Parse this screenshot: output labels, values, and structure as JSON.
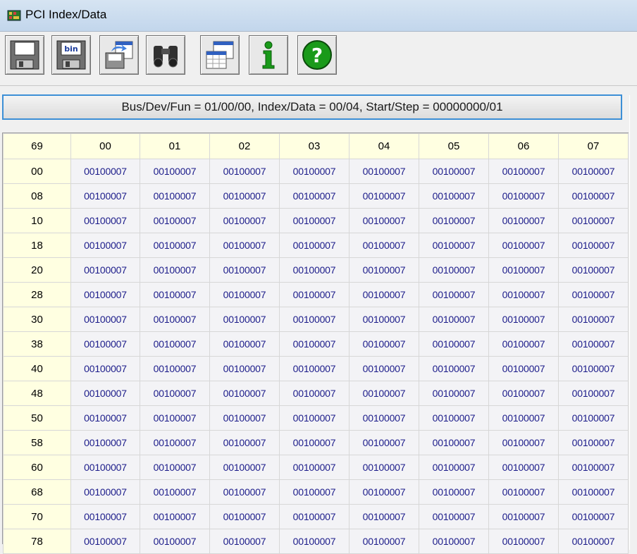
{
  "window": {
    "title": "PCI Index/Data"
  },
  "toolbar": {
    "buttons": [
      {
        "name": "save-button",
        "icon": "floppy-disk-icon"
      },
      {
        "name": "save-binary-button",
        "icon": "floppy-bin-icon"
      },
      {
        "name": "export-button",
        "icon": "export-icon"
      },
      {
        "name": "find-button",
        "icon": "binoculars-icon"
      },
      {
        "name": "view-mode-button",
        "icon": "table-icon"
      },
      {
        "name": "info-button",
        "icon": "info-icon"
      },
      {
        "name": "help-button",
        "icon": "help-icon"
      }
    ]
  },
  "status": {
    "text": "Bus/Dev/Fun = 01/00/00,  Index/Data = 00/04,  Start/Step = 00000000/01"
  },
  "grid": {
    "corner": "69",
    "columns": [
      "00",
      "01",
      "02",
      "03",
      "04",
      "05",
      "06",
      "07"
    ],
    "rows": [
      {
        "label": "00",
        "values": [
          "00100007",
          "00100007",
          "00100007",
          "00100007",
          "00100007",
          "00100007",
          "00100007",
          "00100007"
        ]
      },
      {
        "label": "08",
        "values": [
          "00100007",
          "00100007",
          "00100007",
          "00100007",
          "00100007",
          "00100007",
          "00100007",
          "00100007"
        ]
      },
      {
        "label": "10",
        "values": [
          "00100007",
          "00100007",
          "00100007",
          "00100007",
          "00100007",
          "00100007",
          "00100007",
          "00100007"
        ]
      },
      {
        "label": "18",
        "values": [
          "00100007",
          "00100007",
          "00100007",
          "00100007",
          "00100007",
          "00100007",
          "00100007",
          "00100007"
        ]
      },
      {
        "label": "20",
        "values": [
          "00100007",
          "00100007",
          "00100007",
          "00100007",
          "00100007",
          "00100007",
          "00100007",
          "00100007"
        ]
      },
      {
        "label": "28",
        "values": [
          "00100007",
          "00100007",
          "00100007",
          "00100007",
          "00100007",
          "00100007",
          "00100007",
          "00100007"
        ]
      },
      {
        "label": "30",
        "values": [
          "00100007",
          "00100007",
          "00100007",
          "00100007",
          "00100007",
          "00100007",
          "00100007",
          "00100007"
        ]
      },
      {
        "label": "38",
        "values": [
          "00100007",
          "00100007",
          "00100007",
          "00100007",
          "00100007",
          "00100007",
          "00100007",
          "00100007"
        ]
      },
      {
        "label": "40",
        "values": [
          "00100007",
          "00100007",
          "00100007",
          "00100007",
          "00100007",
          "00100007",
          "00100007",
          "00100007"
        ]
      },
      {
        "label": "48",
        "values": [
          "00100007",
          "00100007",
          "00100007",
          "00100007",
          "00100007",
          "00100007",
          "00100007",
          "00100007"
        ]
      },
      {
        "label": "50",
        "values": [
          "00100007",
          "00100007",
          "00100007",
          "00100007",
          "00100007",
          "00100007",
          "00100007",
          "00100007"
        ]
      },
      {
        "label": "58",
        "values": [
          "00100007",
          "00100007",
          "00100007",
          "00100007",
          "00100007",
          "00100007",
          "00100007",
          "00100007"
        ]
      },
      {
        "label": "60",
        "values": [
          "00100007",
          "00100007",
          "00100007",
          "00100007",
          "00100007",
          "00100007",
          "00100007",
          "00100007"
        ]
      },
      {
        "label": "68",
        "values": [
          "00100007",
          "00100007",
          "00100007",
          "00100007",
          "00100007",
          "00100007",
          "00100007",
          "00100007"
        ]
      },
      {
        "label": "70",
        "values": [
          "00100007",
          "00100007",
          "00100007",
          "00100007",
          "00100007",
          "00100007",
          "00100007",
          "00100007"
        ]
      },
      {
        "label": "78",
        "values": [
          "00100007",
          "00100007",
          "00100007",
          "00100007",
          "00100007",
          "00100007",
          "00100007",
          "00100007"
        ]
      }
    ]
  },
  "colors": {
    "header_bg": "#ffffe1",
    "corner_text": "#d00000",
    "cell_text": "#1c1c8a",
    "status_border": "#3c8fd6"
  }
}
